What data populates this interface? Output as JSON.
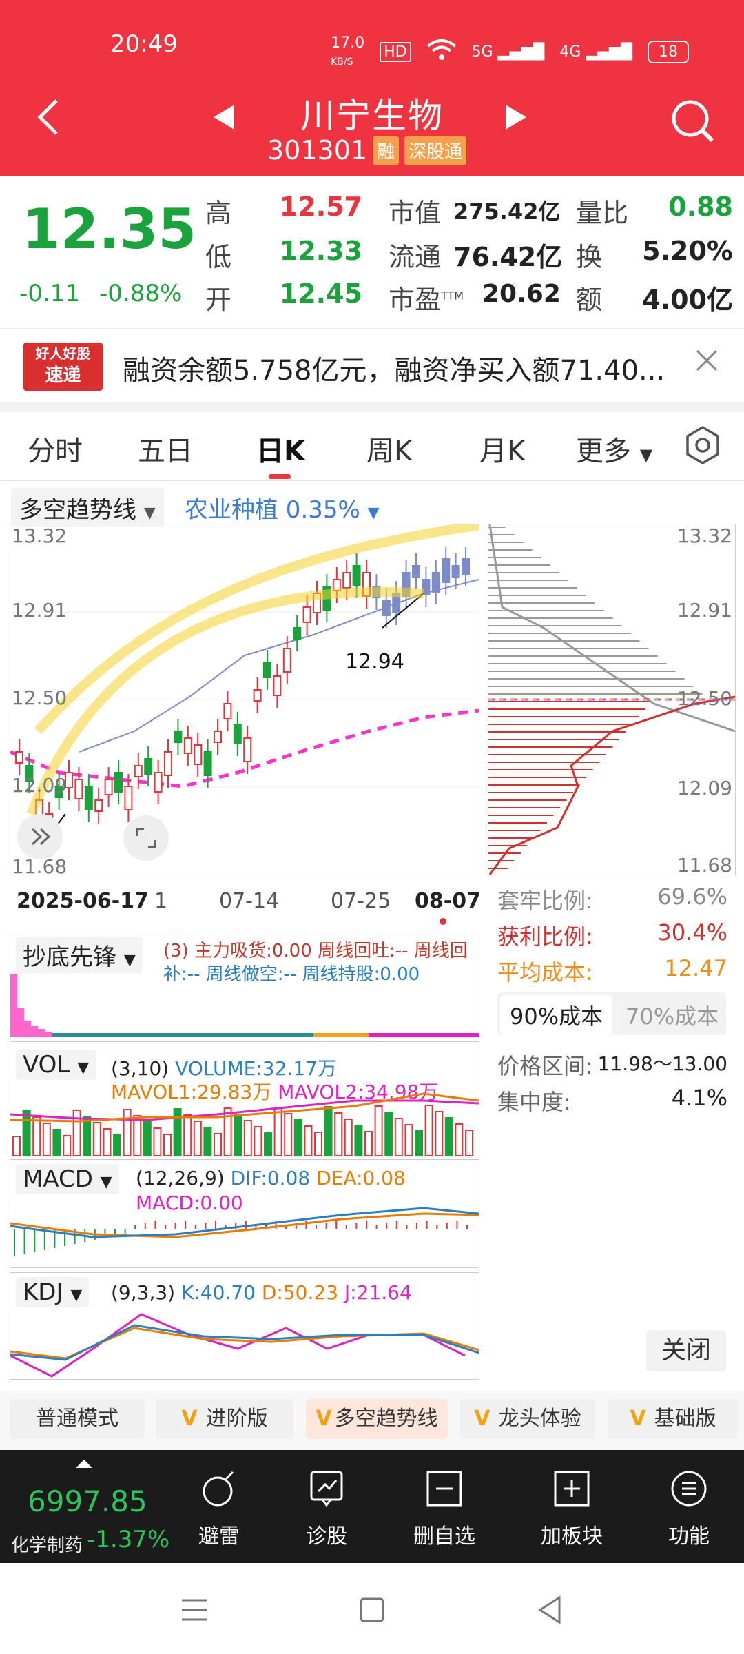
{
  "status": {
    "time": "20:49",
    "speed": "17.0",
    "speed_unit": "KB/S",
    "hd": "HD",
    "net1": "5G",
    "net2": "4G",
    "battery": "18"
  },
  "header": {
    "name": "川宁生物",
    "code": "301301",
    "tag1": "融",
    "tag2": "深股通"
  },
  "quote": {
    "price": "12.35",
    "change": "-0.11",
    "change_pct": "-0.88%",
    "high_label": "高",
    "high": "12.57",
    "low_label": "低",
    "low": "12.33",
    "open_label": "开",
    "open": "12.45",
    "mcap_label": "市值",
    "mcap": "275.42亿",
    "float_label": "流通",
    "float": "76.42亿",
    "pe_label": "市盈",
    "pe_sup": "TTM",
    "pe": "20.62",
    "volratio_label": "量比",
    "volratio": "0.88",
    "turnover_label": "换",
    "turnover": "5.20%",
    "amount_label": "额",
    "amount": "4.00亿"
  },
  "banner": {
    "logo_top": "好人好股",
    "logo_bottom": "速递",
    "text": "融资余额5.758亿元，融资净买入额71.40..."
  },
  "tabs": [
    "分时",
    "五日",
    "日K",
    "周K",
    "月K",
    "更多"
  ],
  "active_tab": "日K",
  "selectors": {
    "indicator": "多空趋势线",
    "sector": "农业种植 0.35%"
  },
  "axis": {
    "y_left": [
      "13.32",
      "12.91",
      "12.50",
      "12.09",
      "11.68"
    ],
    "y_right": [
      "13.32",
      "12.91",
      "12.50",
      "12.09",
      "11.68"
    ],
    "dates": [
      "2025-06-17",
      "07-14",
      "07-25",
      "08-07"
    ],
    "one": "1",
    "annot": "12.94"
  },
  "chip": {
    "taolao_label": "套牢比例:",
    "taolao": "69.6%",
    "profit_label": "获利比例:",
    "profit": "30.4%",
    "avgcost_label": "平均成本:",
    "avgcost": "12.47",
    "tab90": "90%成本",
    "tab70": "70%成本",
    "range_label": "价格区间:",
    "range": "11.98～13.00",
    "conc_label": "集中度:",
    "conc": "4.1%",
    "close": "关闭"
  },
  "panel1": {
    "name": "抄底先锋",
    "line1": "(3) 主力吸货:0.00 周线回吐:-- 周线回",
    "line2": "补:-- 周线做空:-- 周线持股:0.00"
  },
  "panel2": {
    "name": "VOL",
    "params": "(3,10)",
    "volume": "VOLUME:32.17万",
    "mavol1": "MAVOL1:29.83万",
    "mavol2": "MAVOL2:34.98万"
  },
  "panel3": {
    "name": "MACD",
    "params": "(12,26,9)",
    "dif": "DIF:0.08",
    "dea": "DEA:0.08",
    "macd": "MACD:0.00"
  },
  "panel4": {
    "name": "KDJ",
    "params": "(9,3,3)",
    "k": "K:40.70",
    "d": "D:50.23",
    "j": "J:21.64"
  },
  "modes": [
    "普通模式",
    "进阶版",
    "多空趋势线",
    "龙头体验",
    "基础版"
  ],
  "mode_check": "V",
  "index": {
    "value": "6997.85",
    "name": "化学制药",
    "chg": "-1.37%"
  },
  "functions": [
    "避雷",
    "诊股",
    "删自选",
    "加板块",
    "功能"
  ]
}
